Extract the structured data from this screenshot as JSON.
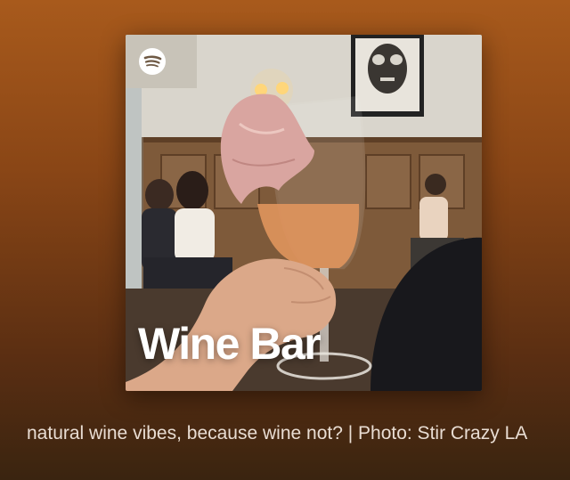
{
  "playlist": {
    "cover_title": "Wine Bar",
    "description": "natural wine vibes, because wine not? | Photo: Stir Crazy LA"
  },
  "cover": {
    "logo_icon": "spotify-icon"
  },
  "colors": {
    "background_top": "#a85a1c",
    "background_bottom": "#3a2410",
    "description_text": "#e9ddd3"
  }
}
